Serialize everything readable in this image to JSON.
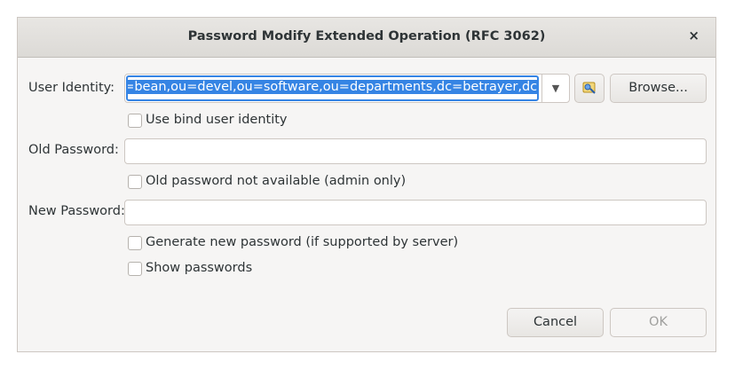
{
  "dialog": {
    "title": "Password Modify Extended Operation (RFC 3062)",
    "close_glyph": "×"
  },
  "user_identity": {
    "label": "User Identity:",
    "value": "uid=bean,ou=devel,ou=software,ou=departments,dc=betrayer,dc=com",
    "visible_value": "d=bean,ou=devel,ou=software,ou=departments,dc=betrayer,dc=com",
    "dropdown_glyph": "▼",
    "entry_picker_icon": "entry-picker-icon",
    "browse_label": "Browse..."
  },
  "use_bind_identity": {
    "label": "Use bind user identity",
    "checked": false
  },
  "old_password": {
    "label": "Old Password:",
    "value": ""
  },
  "old_not_available": {
    "label": "Old password not available (admin only)",
    "checked": false
  },
  "new_password": {
    "label": "New Password:",
    "value": ""
  },
  "generate_password": {
    "label": "Generate new password (if supported by server)",
    "checked": false
  },
  "show_passwords": {
    "label": "Show passwords",
    "checked": false
  },
  "buttons": {
    "cancel": "Cancel",
    "ok": "OK"
  },
  "colors": {
    "accent": "#3584e4",
    "dialog_bg": "#f6f5f4",
    "border": "#cdc7c2"
  }
}
